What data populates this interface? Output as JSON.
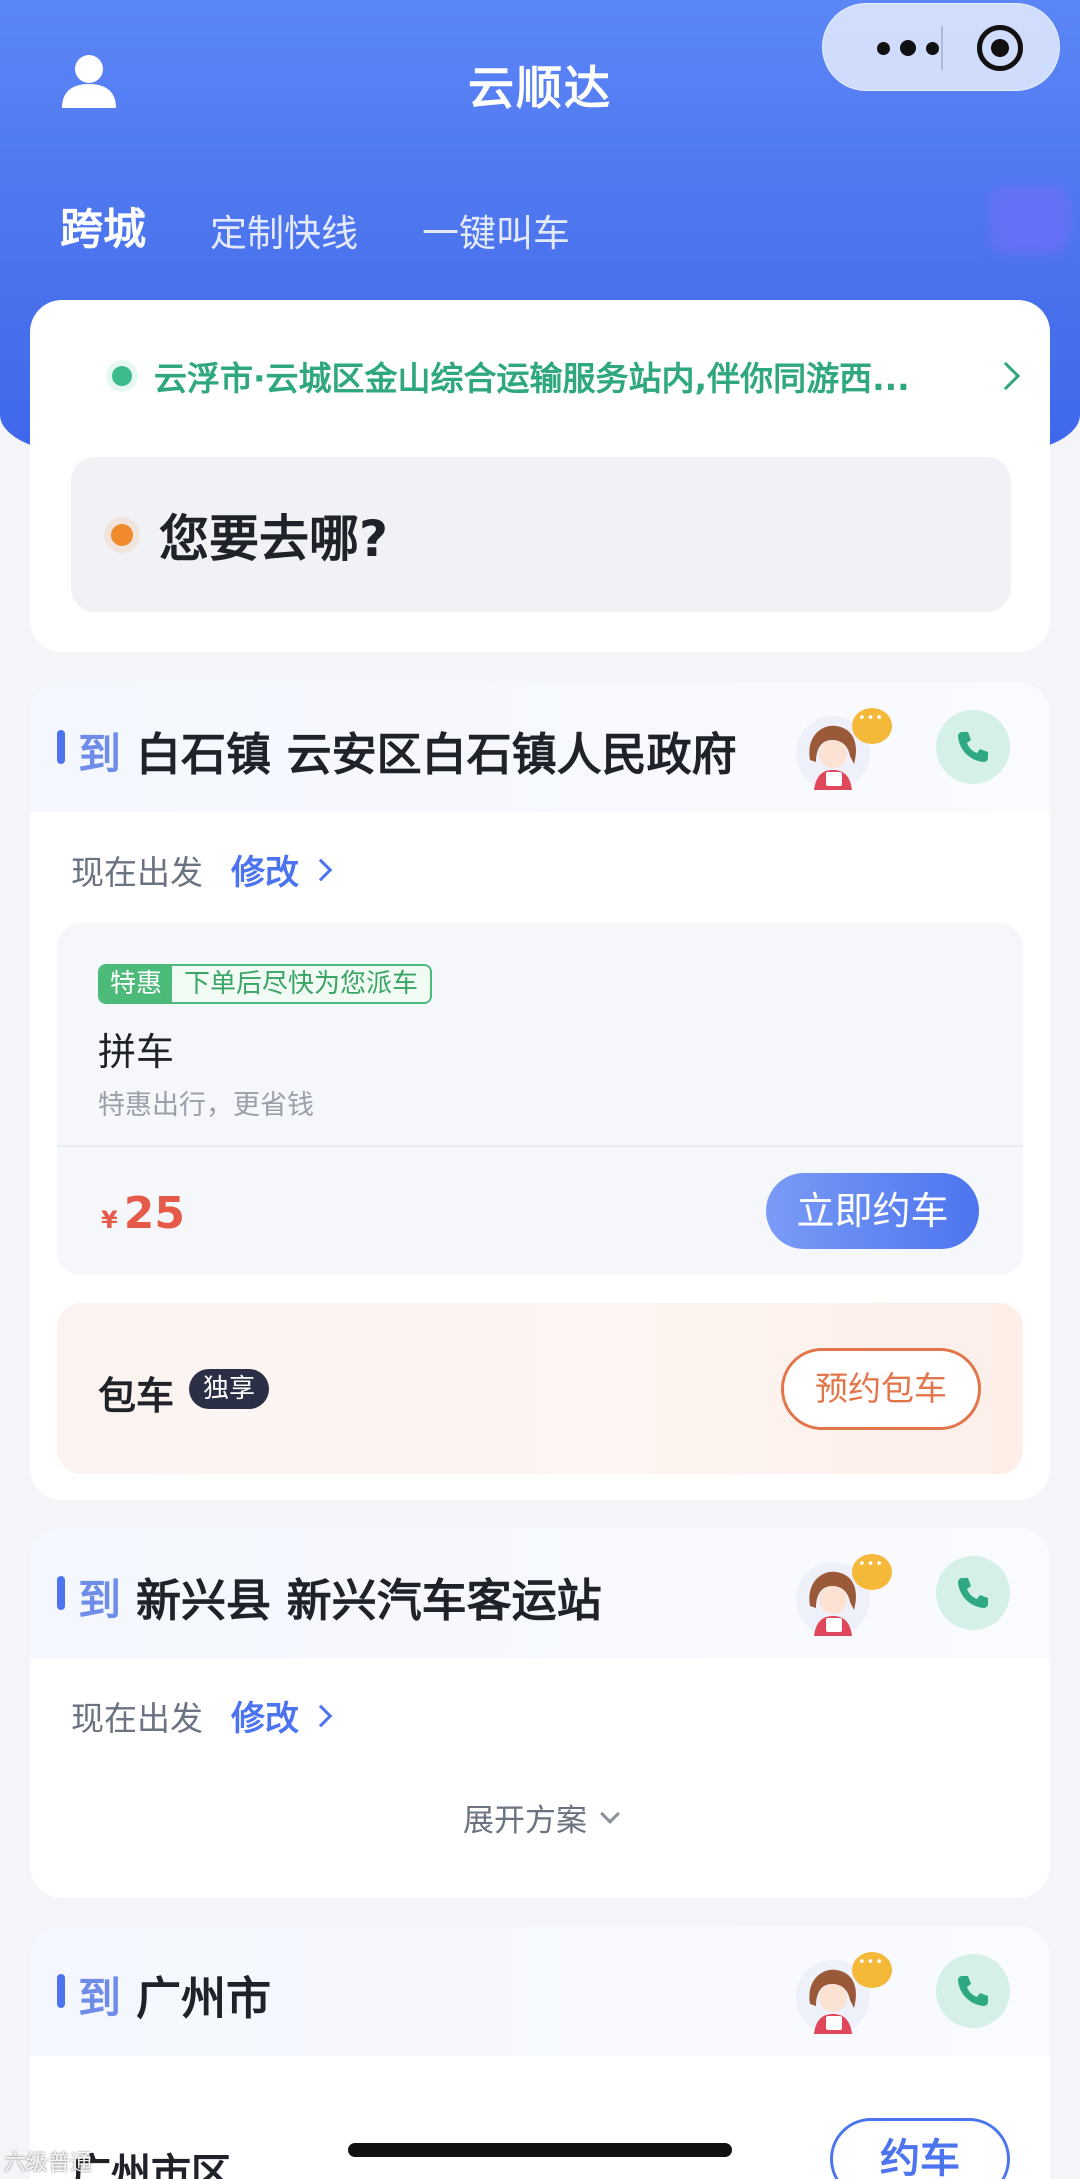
{
  "header": {
    "title": "云顺达",
    "user_icon": "user-icon",
    "capsule": {
      "more_icon": "more-dots-icon",
      "close_icon": "target-icon"
    }
  },
  "tabs": [
    {
      "label": "跨城",
      "active": true
    },
    {
      "label": "定制快线",
      "active": false
    },
    {
      "label": "一键叫车",
      "active": false
    }
  ],
  "location": {
    "from": "云浮市·云城区金山综合运输服务站内,伴你同游西...",
    "to_placeholder": "您要去哪?"
  },
  "routes": [
    {
      "to_prefix": "到",
      "destination": "白石镇 云安区白石镇人民政府",
      "depart_label": "现在出发",
      "modify_label": "修改",
      "pool": {
        "badge": "特惠",
        "badge_desc": "下单后尽快为您派车",
        "title": "拼车",
        "subtitle": "特惠出行，更省钱",
        "currency": "¥",
        "price": "25",
        "button": "立即约车"
      },
      "charter": {
        "title": "包车",
        "tag": "独享",
        "button": "预约包车"
      }
    },
    {
      "to_prefix": "到",
      "destination": "新兴县 新兴汽车客运站",
      "depart_label": "现在出发",
      "modify_label": "修改",
      "expand_label": "展开方案"
    },
    {
      "to_prefix": "到",
      "destination": "广州市",
      "city": "广州市区",
      "button": "约车"
    }
  ],
  "watermark": "六级普通",
  "colors": {
    "brand_blue": "#4c74ee",
    "green": "#2fa87f",
    "orange": "#f08a2c",
    "price_red": "#e65a4a"
  }
}
